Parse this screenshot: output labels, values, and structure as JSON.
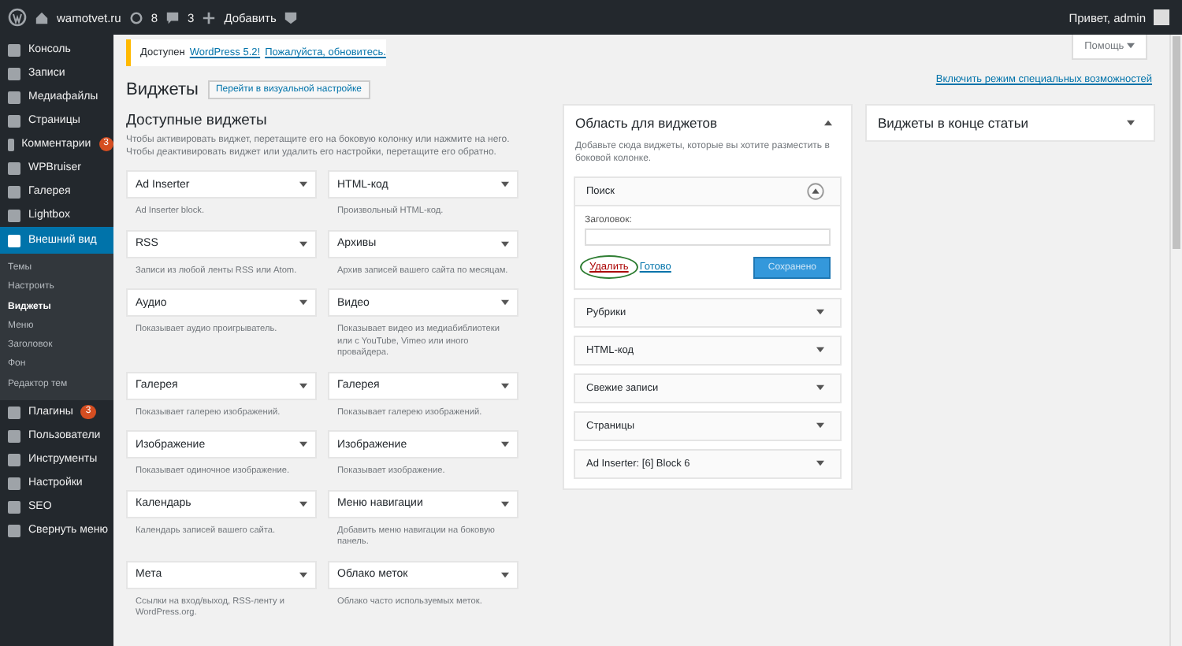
{
  "admin_bar": {
    "site": "wamotvet.ru",
    "updates": "8",
    "comments": "3",
    "add": "Добавить",
    "greeting": "Привет, admin"
  },
  "sidebar": {
    "items": [
      {
        "label": "Консоль",
        "selected": false
      },
      {
        "label": "Записи",
        "selected": false
      },
      {
        "label": "Медиафайлы",
        "selected": false
      },
      {
        "label": "Страницы",
        "selected": false
      },
      {
        "label": "Комментарии",
        "badge": "3",
        "selected": false
      },
      {
        "label": "WPBruiser",
        "selected": false
      },
      {
        "label": "Галерея",
        "selected": false
      },
      {
        "label": "Lightbox",
        "selected": false
      },
      {
        "label": "Внешний вид",
        "selected": true,
        "children": [
          {
            "label": "Темы",
            "selected": false
          },
          {
            "label": "Настроить",
            "selected": false
          },
          {
            "label": "Виджеты",
            "selected": true
          },
          {
            "label": "Меню",
            "selected": false
          },
          {
            "label": "Заголовок",
            "selected": false
          },
          {
            "label": "Фон",
            "selected": false
          },
          {
            "label": "Редактор тем",
            "selected": false
          }
        ]
      },
      {
        "label": "Плагины",
        "badge": "3",
        "selected": false
      },
      {
        "label": "Пользователи",
        "selected": false
      },
      {
        "label": "Инструменты",
        "selected": false
      },
      {
        "label": "Настройки",
        "selected": false
      },
      {
        "label": "SEO",
        "selected": false
      },
      {
        "label": "Свернуть меню",
        "selected": false
      }
    ]
  },
  "help_button": "Помощь",
  "notice": {
    "text": "Доступен",
    "link": "WordPress 5.2!",
    "link2": "Пожалуйста, обновитесь."
  },
  "title": "Виджеты",
  "title_button": "Перейти в визуальной настройке",
  "accessibility_link": "Включить режим специальных возможностей",
  "available": {
    "heading": "Доступные виджеты",
    "description": "Чтобы активировать виджет, перетащите его на боковую колонку или нажмите на него. Чтобы деактивировать виджет или удалить его настройки, перетащите его обратно.",
    "widgets": [
      {
        "title": "Ad Inserter",
        "description": "Ad Inserter block."
      },
      {
        "title": "HTML-код",
        "description": "Произвольный HTML-код."
      },
      {
        "title": "RSS",
        "description": "Записи из любой ленты RSS или Atom."
      },
      {
        "title": "Архивы",
        "description": "Архив записей вашего сайта по месяцам."
      },
      {
        "title": "Аудио",
        "description": "Показывает аудио проигрыватель."
      },
      {
        "title": "Видео",
        "description": "Показывает видео из медиабиблиотеки или с YouTube, Vimeo или иного провайдера."
      },
      {
        "title": "Галерея",
        "description": "Показывает галерею изображений."
      },
      {
        "title": "Галерея",
        "description": "Показывает галерею изображений."
      },
      {
        "title": "Изображение",
        "description": "Показывает одиночное изображение."
      },
      {
        "title": "Изображение",
        "description": "Показывает изображение."
      },
      {
        "title": "Календарь",
        "description": "Календарь записей вашего сайта."
      },
      {
        "title": "Меню навигации",
        "description": "Добавить меню навигации на боковую панель."
      },
      {
        "title": "Мета",
        "description": "Ссылки на вход/выход, RSS-ленту и WordPress.org."
      },
      {
        "title": "Облако меток",
        "description": "Облако часто используемых меток."
      }
    ]
  },
  "areas": [
    {
      "title": "Область для виджетов",
      "expanded": true,
      "description": "Добавьте сюда виджеты, которые вы хотите разместить в боковой колонке.",
      "widgets": [
        {
          "title": "Поиск",
          "expanded": true,
          "field_label": "Заголовок:",
          "delete_link": "Удалить",
          "done_link": "Готово",
          "save_button": "Сохранено"
        },
        {
          "title": "Рубрики",
          "expanded": false
        },
        {
          "title": "HTML-код",
          "expanded": false
        },
        {
          "title": "Свежие записи",
          "expanded": false
        },
        {
          "title": "Страницы",
          "expanded": false
        },
        {
          "title": "Ad Inserter: [6] Block 6",
          "expanded": false
        }
      ]
    },
    {
      "title": "Виджеты в конце статьи",
      "expanded": false
    }
  ]
}
